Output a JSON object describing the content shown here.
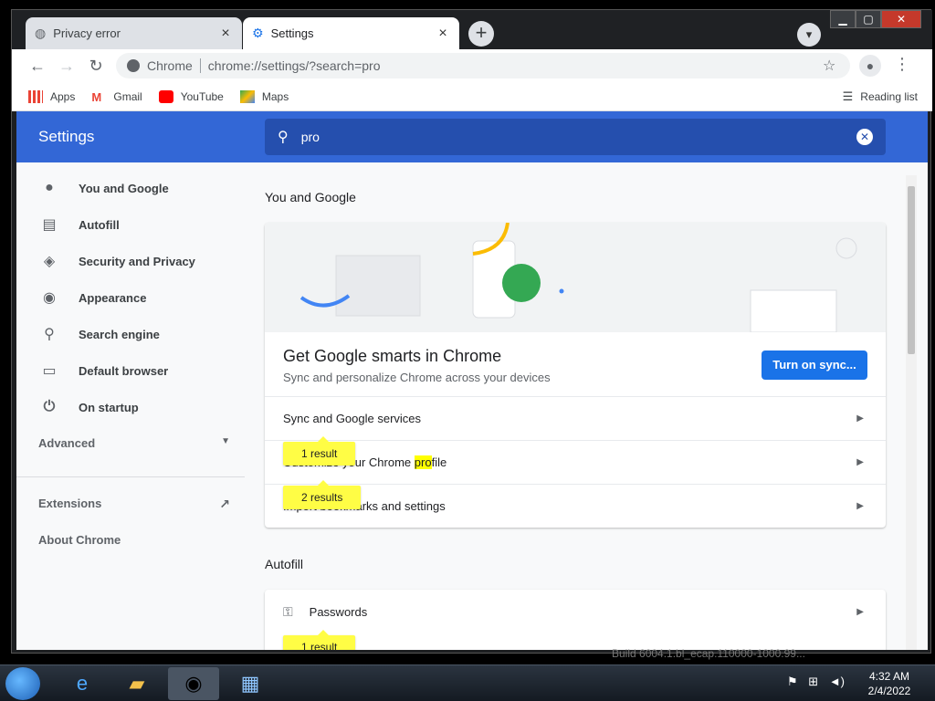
{
  "tabs": [
    {
      "title": "Privacy error",
      "icon": "globe-icon"
    },
    {
      "title": "Settings",
      "icon": "gear-icon"
    }
  ],
  "toolbar": {
    "site_label": "Chrome",
    "url": "chrome://settings/?search=pro"
  },
  "bookmarks": [
    {
      "label": "Apps",
      "icon": "apps-grid-icon"
    },
    {
      "label": "Gmail",
      "icon": "gmail-icon"
    },
    {
      "label": "YouTube",
      "icon": "youtube-icon"
    },
    {
      "label": "Maps",
      "icon": "maps-icon"
    }
  ],
  "reading_list": "Reading list",
  "settings": {
    "title": "Settings",
    "search_query": "pro"
  },
  "sidebar": {
    "items": [
      {
        "label": "You and Google",
        "icon": "person-icon"
      },
      {
        "label": "Autofill",
        "icon": "clipboard-icon"
      },
      {
        "label": "Security and Privacy",
        "icon": "shield-icon"
      },
      {
        "label": "Appearance",
        "icon": "palette-icon"
      },
      {
        "label": "Search engine",
        "icon": "search-icon"
      },
      {
        "label": "Default browser",
        "icon": "browser-icon"
      },
      {
        "label": "On startup",
        "icon": "power-icon"
      }
    ],
    "advanced": "Advanced",
    "extensions": "Extensions",
    "about": "About Chrome"
  },
  "main": {
    "section1_title": "You and Google",
    "sync_title": "Get Google smarts in Chrome",
    "sync_subtitle": "Sync and personalize Chrome across your devices",
    "sync_button": "Turn on sync...",
    "rows": [
      {
        "label": "Sync and Google services"
      },
      {
        "label_before": "Customize your Chrome ",
        "label_highlight": "pro",
        "label_after": "file"
      },
      {
        "label": "Import bookmarks and settings"
      }
    ],
    "bubbles": [
      "1 result",
      "2 results"
    ],
    "section2_title": "Autofill",
    "passwords_label": "Passwords",
    "passwords_bubble": "1 result"
  },
  "build_text": "Build 6004.1.bl_ecap.110000-1000.99...",
  "clock": {
    "time": "4:32 AM",
    "date": "2/4/2022"
  },
  "colors": {
    "header": "#3367d6",
    "search": "#254fae",
    "accent": "#1a73e8",
    "highlight": "#ffff00"
  }
}
